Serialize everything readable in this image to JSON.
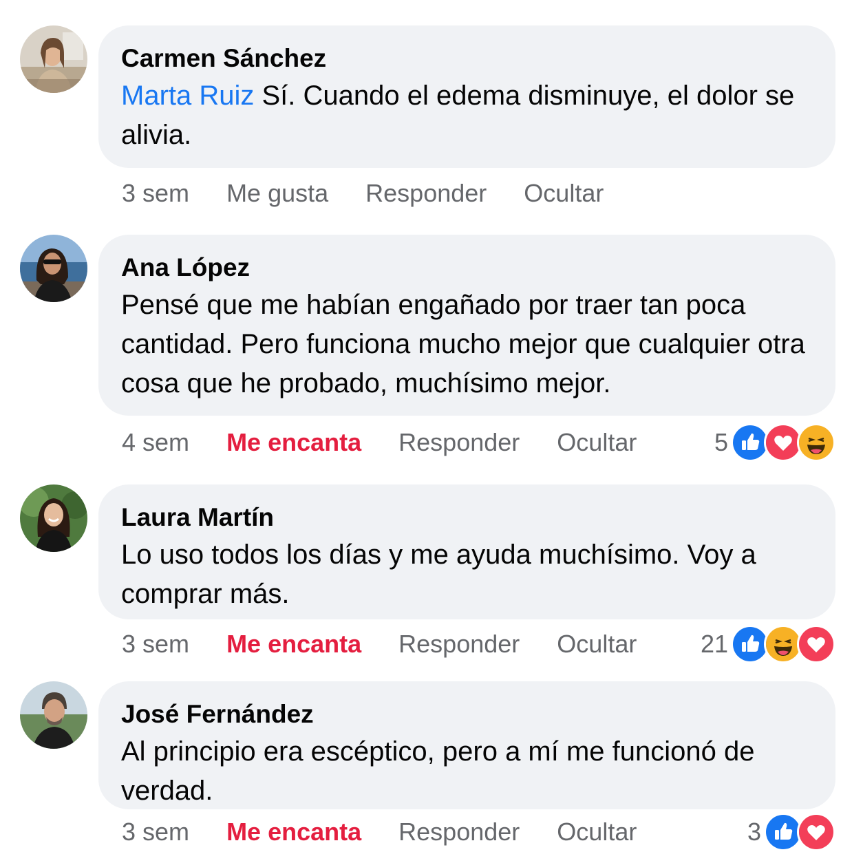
{
  "comments": [
    {
      "author": "Carmen Sánchez",
      "mention": "Marta Ruiz",
      "text": " Sí. Cuando el edema disminuye, el dolor se alivia.",
      "time": "3 sem",
      "like_label": "Me gusta",
      "reply_label": "Responder",
      "hide_label": "Ocultar",
      "reaction_count": "",
      "reactions": []
    },
    {
      "author": "Ana López",
      "mention": "",
      "text": "Pensé que me habían engañado por traer tan poca cantidad. Pero funciona mucho mejor que cualquier otra cosa que he probado, muchísimo mejor.",
      "time": "4 sem",
      "like_label": "Me encanta",
      "reply_label": "Responder",
      "hide_label": "Ocultar",
      "reaction_count": "5",
      "reactions": [
        "like-icon",
        "love-icon",
        "haha-icon"
      ]
    },
    {
      "author": "Laura Martín",
      "mention": "",
      "text": "Lo uso todos los días y me ayuda muchísimo. Voy a comprar más.",
      "time": "3 sem",
      "like_label": "Me encanta",
      "reply_label": "Responder",
      "hide_label": "Ocultar",
      "reaction_count": "21",
      "reactions": [
        "like-icon",
        "haha-icon",
        "love-icon"
      ]
    },
    {
      "author": "José Fernández",
      "mention": "",
      "text": "Al principio era escéptico, pero a mí me funcionó de verdad.",
      "time": "3 sem",
      "like_label": "Me encanta",
      "reply_label": "Responder",
      "hide_label": "Ocultar",
      "reaction_count": "3",
      "reactions": [
        "like-icon",
        "love-icon"
      ]
    }
  ],
  "colors": {
    "bubble": "#f0f2f5",
    "mention": "#1877f2",
    "love_label": "#e41e3f",
    "meta": "#65676b"
  }
}
